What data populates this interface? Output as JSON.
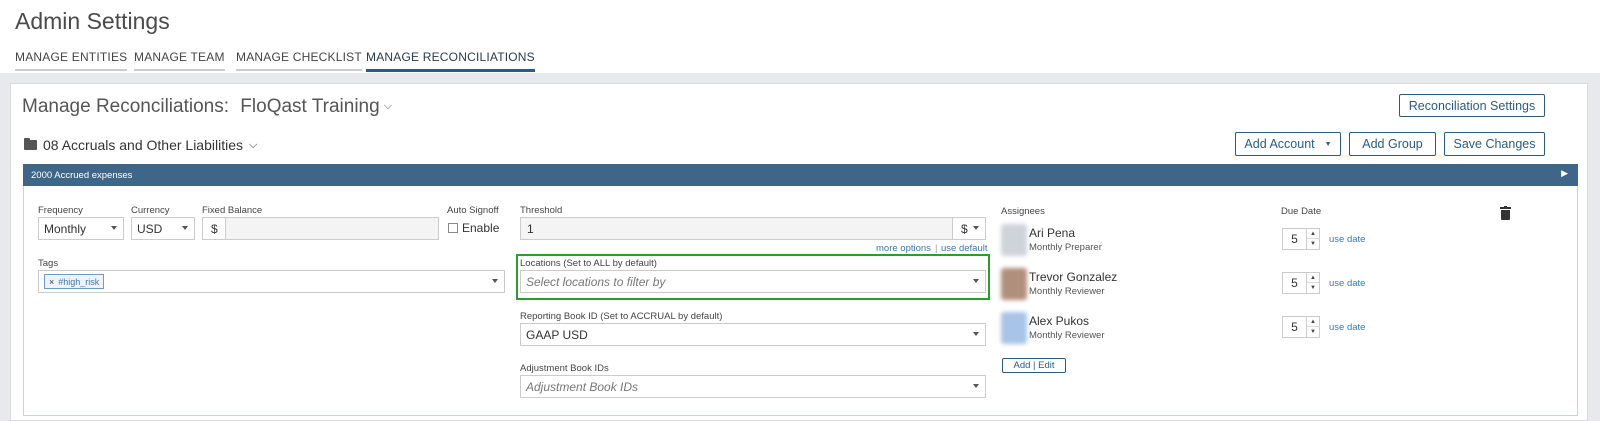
{
  "app_title": "Admin Settings",
  "tabs": [
    {
      "label": "MANAGE ENTITIES"
    },
    {
      "label": "MANAGE TEAM"
    },
    {
      "label": "MANAGE CHECKLIST"
    },
    {
      "label": "MANAGE RECONCILIATIONS",
      "active": true
    }
  ],
  "page": {
    "title": "Manage Reconciliations:",
    "entity": "FloQast Training",
    "settings_button": "Reconciliation Settings"
  },
  "toolbar": {
    "add_account": "Add Account",
    "add_group": "Add Group",
    "save_changes": "Save Changes"
  },
  "group": {
    "name": "08 Accruals and Other Liabilities"
  },
  "account": {
    "name": "2000 Accrued expenses",
    "frequency": {
      "label": "Frequency",
      "value": "Monthly"
    },
    "currency": {
      "label": "Currency",
      "value": "USD"
    },
    "fixed_balance": {
      "label": "Fixed Balance",
      "prefix": "$",
      "value": ""
    },
    "auto_signoff": {
      "label": "Auto Signoff",
      "option": "Enable",
      "checked": false
    },
    "tags": {
      "label": "Tags",
      "items": [
        "#high_risk"
      ],
      "remove_glyph": "×"
    },
    "threshold": {
      "label": "Threshold",
      "value": "1",
      "unit": "$"
    },
    "more_options": "more options",
    "link_sep": "|",
    "use_default": "use default",
    "locations": {
      "label": "Locations (Set to ALL by default)",
      "placeholder": "Select locations to filter by"
    },
    "reporting_book": {
      "label": "Reporting Book ID (Set to ACCRUAL by default)",
      "value": "GAAP USD"
    },
    "adjustment_books": {
      "label": "Adjustment Book IDs",
      "placeholder": "Adjustment Book IDs"
    },
    "assignees_label": "Assignees",
    "due_date_label": "Due Date",
    "assignees": [
      {
        "name": "Ari Pena",
        "role": "Monthly Preparer",
        "due": "5",
        "link": "use date",
        "avatar_color": "#cfd3da"
      },
      {
        "name": "Trevor Gonzalez",
        "role": "Monthly Reviewer",
        "due": "5",
        "link": "use date",
        "avatar_color": "#b08f7c"
      },
      {
        "name": "Alex Pukos",
        "role": "Monthly Reviewer",
        "due": "5",
        "link": "use date",
        "avatar_color": "#a8c4e6"
      }
    ],
    "add_edit": "Add | Edit"
  },
  "colors": {
    "accent": "#2d5b80",
    "account_bar": "#3e6689",
    "highlight": "#2e9b2e",
    "link": "#3d78b0"
  }
}
